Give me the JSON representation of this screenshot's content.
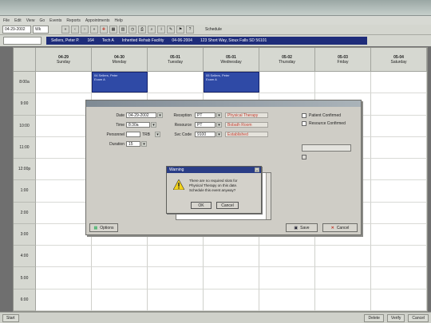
{
  "window": {
    "title": ""
  },
  "menu": [
    "File",
    "Edit",
    "View",
    "Go",
    "Events",
    "Reports",
    "Appointments",
    "Help"
  ],
  "toolbar": {
    "date_value": "04-29-2002",
    "view_value": "Wk",
    "right_label": "Schedule"
  },
  "patient_bar": {
    "selector": "",
    "name": "Sellers, Peter P.",
    "age": "164",
    "tech": "Tech A",
    "facility": "Inherited Rehab Facility",
    "date": "04-06-2004",
    "address": "123 Short Way, Sioux Falls SD 56101"
  },
  "calendar": {
    "days": [
      {
        "date": "04-29",
        "weekday": "Sunday"
      },
      {
        "date": "04-30",
        "weekday": "Monday"
      },
      {
        "date": "05-01",
        "weekday": "Tuesday"
      },
      {
        "date": "05-01",
        "weekday": "Wednesday"
      },
      {
        "date": "05-02",
        "weekday": "Thursday"
      },
      {
        "date": "05-03",
        "weekday": "Friday"
      },
      {
        "date": "05-04",
        "weekday": "Saturday"
      }
    ],
    "times": [
      "8:00a",
      "9:00",
      "10:00",
      "11:00",
      "12:00p",
      "1:00",
      "2:00",
      "3:00",
      "4:00",
      "5:00",
      "6:00"
    ],
    "appointments": [
      {
        "line1": "04 Sellers, Peter",
        "line2": "Exam A"
      },
      {
        "line1": "05 Sellers, Peter",
        "line2": "Exam A"
      }
    ]
  },
  "dialog": {
    "title": "",
    "fields": {
      "date_label": "Date",
      "date_value": "04-29-2002",
      "time_label": "Time",
      "time_value": "8:30a",
      "provider_label": "Personnel",
      "provider_value": "",
      "provider_extra": "TRB",
      "duration_label": "Duration",
      "duration_value": "15",
      "reception_label": "Reception",
      "reception_value": "PT",
      "reception_desc": "Physical Therapy",
      "reason_label": "Resource",
      "reason_value": "PT",
      "reason_desc": "Bobath Room",
      "svc_label": "Svc Code",
      "svc_value": "9100",
      "svc_desc": "Established"
    },
    "checks": {
      "patient_confirmed": "Patient Confirmed",
      "resource_confirmed": "Resource Confirmed"
    },
    "buttons": {
      "options": "Options",
      "save": "Save",
      "cancel": "Cancel"
    }
  },
  "warning": {
    "title": "Warning",
    "message_1": "There are no required slots for",
    "message_2": "Physical Therapy on this date.",
    "message_3": "Schedule this event anyway?",
    "ok": "OK",
    "cancel": "Cancel"
  },
  "statusbar": {
    "start": "Start",
    "b1": "Delete",
    "b2": "Verify",
    "b3": "Cancel"
  },
  "colors": {
    "patient_strip": "#1e2c7a",
    "appointment": "#2f4aa6",
    "warning_title": "#2a3d86",
    "alert_icon": "#f2d21b"
  }
}
